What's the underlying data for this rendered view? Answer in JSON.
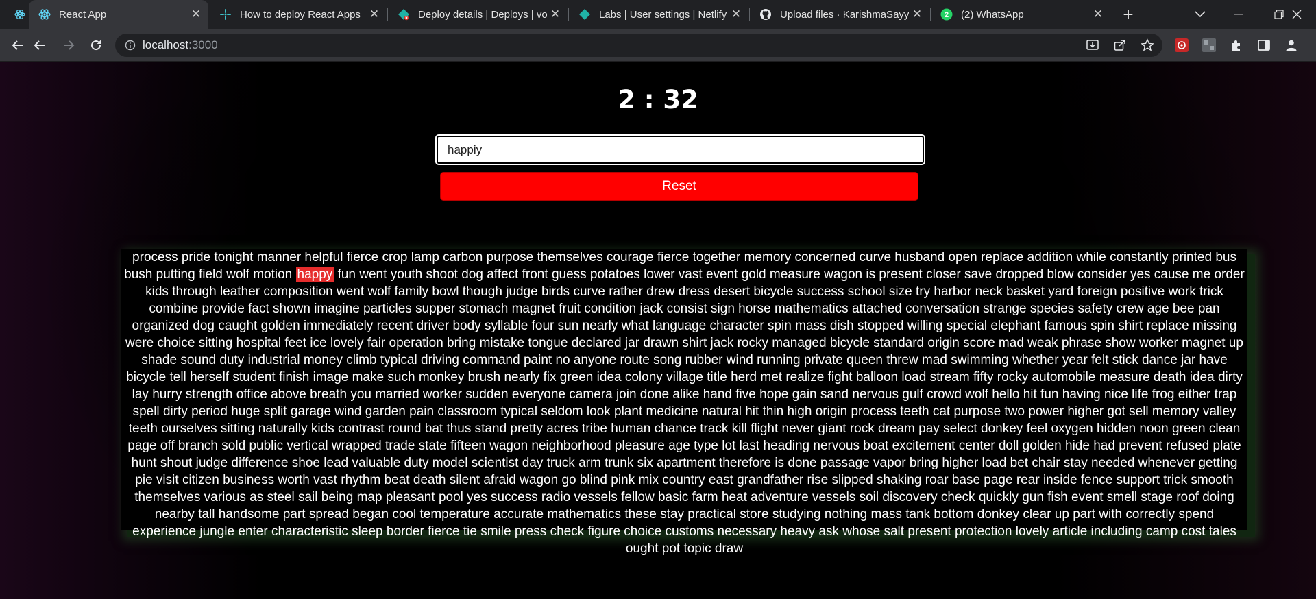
{
  "browser": {
    "tabs": [
      {
        "title": "React App",
        "icon": "react-icon",
        "active": true
      },
      {
        "title": "How to deploy React Apps",
        "icon": "deploy-icon",
        "active": false
      },
      {
        "title": "Deploy details | Deploys | vo",
        "icon": "netlify-icon",
        "active": false
      },
      {
        "title": "Labs | User settings | Netlify",
        "icon": "netlify-icon",
        "active": false
      },
      {
        "title": "Upload files · KarishmaSayy",
        "icon": "github-icon",
        "active": false
      },
      {
        "title": "(2) WhatsApp",
        "icon": "whatsapp-icon",
        "active": false
      }
    ],
    "whatsapp_badge": "2",
    "url_host": "localhost",
    "url_port": ":3000"
  },
  "app": {
    "timer": "2 : 32",
    "input_value": "happiy",
    "reset_label": "Reset",
    "current_word_index": 30,
    "colors": {
      "reset": "#ff0000",
      "highlight": "#e62c2c"
    },
    "words": "process pride tonight manner helpful fierce crop lamp carbon purpose themselves courage fierce together memory concerned curve husband open replace addition while constantly printed bus bush putting field wolf motion happy fun went youth shoot dog affect front guess potatoes lower vast event gold measure wagon is present closer save dropped blow consider yes cause me order kids through leather composition went wolf family bowl though judge birds curve rather drew dress desert bicycle success school size try harbor neck basket yard foreign positive work trick combine provide fact shown imagine particles supper stomach magnet fruit condition jack consist sign horse mathematics attached conversation strange species safety crew age bee pan organized dog caught golden immediately recent driver body syllable four sun nearly what language character spin mass dish stopped willing special elephant famous spin shirt replace missing were choice sitting hospital feet ice lovely fair operation bring mistake tongue declared jar drawn shirt jack rocky managed bicycle standard origin score mad weak phrase show worker magnet up shade sound duty industrial money climb typical driving command paint no anyone route song rubber wind running private queen threw mad swimming whether year felt stick dance jar have bicycle tell herself student finish image make such monkey brush nearly fix green idea colony village title herd met realize fight balloon load stream fifty rocky automobile measure death idea dirty lay hurry strength office above breath you married worker sudden everyone camera join done alike hand five hope gain sand nervous gulf crowd wolf hello hit fun having nice life frog either trap spell dirty period huge split garage wind garden pain classroom typical seldom look plant medicine natural hit thin high origin process teeth cat purpose two power higher got sell memory valley teeth ourselves sitting naturally kids contrast round bat thus stand pretty acres tribe human chance track kill flight never giant rock dream pay select donkey feel oxygen hidden noon green clean page off branch sold public vertical wrapped trade state fifteen wagon neighborhood pleasure age type lot last heading nervous boat excitement center doll golden hide had prevent refused plate hunt shout judge difference shoe lead valuable duty model scientist day truck arm trunk six apartment therefore is done passage vapor bring higher load bet chair stay needed whenever getting pie visit citizen business worth vast rhythm beat death silent afraid wagon go blind pink mix country east grandfather rise slipped shaking roar base page rear inside fence support trick smooth themselves various as steel sail being map pleasant pool yes success radio vessels fellow basic farm heat adventure vessels soil discovery check quickly gun fish event smell stage roof doing nearby tall handsome part spread began cool temperature accurate mathematics these stay practical store studying nothing mass tank bottom donkey clear up part with correctly spend experience jungle enter characteristic sleep border fierce tie smile press check figure choice customs necessary heavy ask whose salt present protection lovely article including camp cost tales ought pot topic draw"
  }
}
